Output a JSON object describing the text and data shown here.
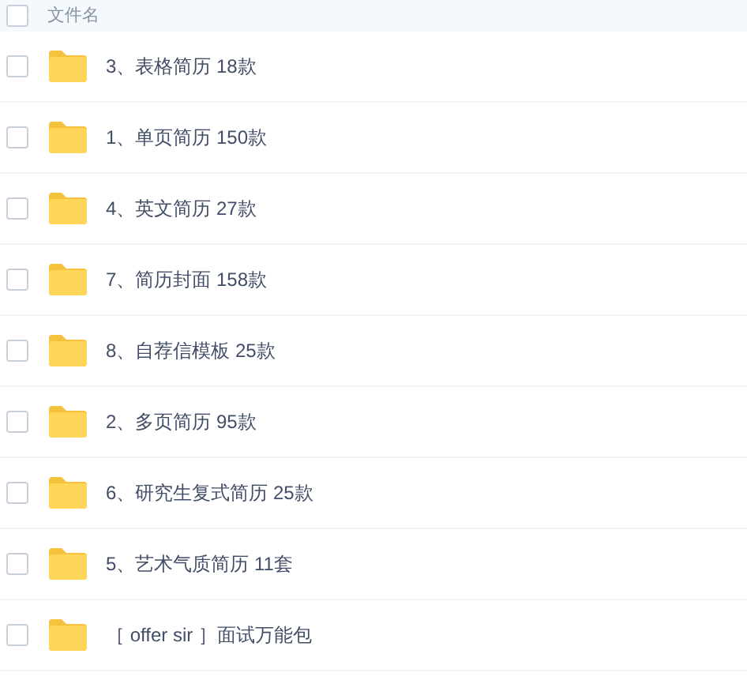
{
  "table": {
    "header": {
      "label": "文件名",
      "checked": false
    },
    "rows": [
      {
        "name": "3、表格简历 18款",
        "checked": false
      },
      {
        "name": "1、单页简历 150款",
        "checked": false
      },
      {
        "name": "4、英文简历 27款",
        "checked": false
      },
      {
        "name": "7、简历封面 158款",
        "checked": false
      },
      {
        "name": "8、自荐信模板 25款",
        "checked": false
      },
      {
        "name": "2、多页简历 95款",
        "checked": false
      },
      {
        "name": "6、研究生复式简历 25款",
        "checked": false
      },
      {
        "name": "5、艺术气质简历 11套",
        "checked": false
      },
      {
        "name": "［ offer sir ］面试万能包",
        "checked": false
      }
    ]
  }
}
